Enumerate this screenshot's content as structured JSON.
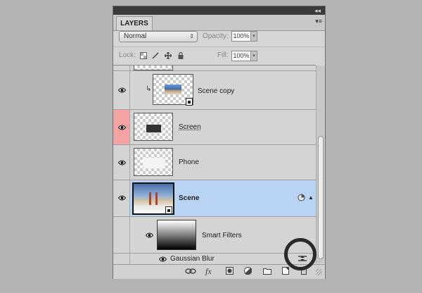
{
  "panel": {
    "tab_label": "LAYERS",
    "collapse_icon": "double-chevron-right",
    "menu_icon": "panel-menu-icon"
  },
  "blend_mode": {
    "value": "Normal"
  },
  "opacity": {
    "label": "Opacity:",
    "value": "100%"
  },
  "lock": {
    "label": "Lock:"
  },
  "fill": {
    "label": "Fill:",
    "value": "100%"
  },
  "layers": [
    {
      "name": "Scene copy",
      "visible": true,
      "clipped": true,
      "smart_object": true
    },
    {
      "name": "Screen",
      "visible": true,
      "highlighted_color": "#f4a3a3"
    },
    {
      "name": "Phone",
      "visible": true
    },
    {
      "name": "Scene",
      "visible": true,
      "selected": true,
      "smart_object": true,
      "selection_color": "#b9d3f5"
    }
  ],
  "smart_filters": {
    "label": "Smart Filters"
  },
  "filters": [
    {
      "name": "Gaussian Blur"
    }
  ],
  "colors": {
    "selection": "#b9d3f5",
    "red_label": "#f4a3a3",
    "panel_bg": "#d6d6d6",
    "page_bg": "#b3b3b3"
  }
}
